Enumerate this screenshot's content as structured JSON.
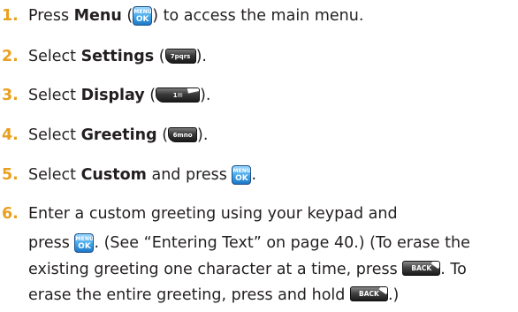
{
  "steps": [
    {
      "num": "1.",
      "pre": "Press ",
      "bold": "Menu",
      "mid": " (",
      "key": "menu",
      "post": ") to access the main menu."
    },
    {
      "num": "2.",
      "pre": "Select ",
      "bold": "Settings",
      "mid": " (",
      "key": "7",
      "post": ")."
    },
    {
      "num": "3.",
      "pre": "Select ",
      "bold": "Display",
      "mid": " (",
      "key": "1",
      "post": ")."
    },
    {
      "num": "4.",
      "pre": "Select ",
      "bold": "Greeting",
      "mid": " (",
      "key": "6",
      "post": ")."
    },
    {
      "num": "5.",
      "pre": "Select ",
      "bold": "Custom",
      "mid": " and press ",
      "key": "menu",
      "post": "."
    },
    {
      "num": "6.",
      "line1": "Enter a custom greeting using your keypad and",
      "line2_pre": "press ",
      "line2_post": ". (See “Entering Text” on page 40.) (To erase the",
      "line3_pre": "existing greeting one character at a time, press ",
      "line3_post": ". To",
      "line4_pre": "erase the entire greeting, press and hold ",
      "line4_post": ".)"
    }
  ],
  "keys": {
    "menu_top": "MENU",
    "menu_bottom": "OK",
    "key7": "7pqrs",
    "key1": "1✉",
    "key6": "6mno",
    "back": "BACK"
  },
  "colors": {
    "step_number": "#e8a020",
    "menu_key": "#3fa7ea",
    "dark_key": "#2a2a2a"
  }
}
